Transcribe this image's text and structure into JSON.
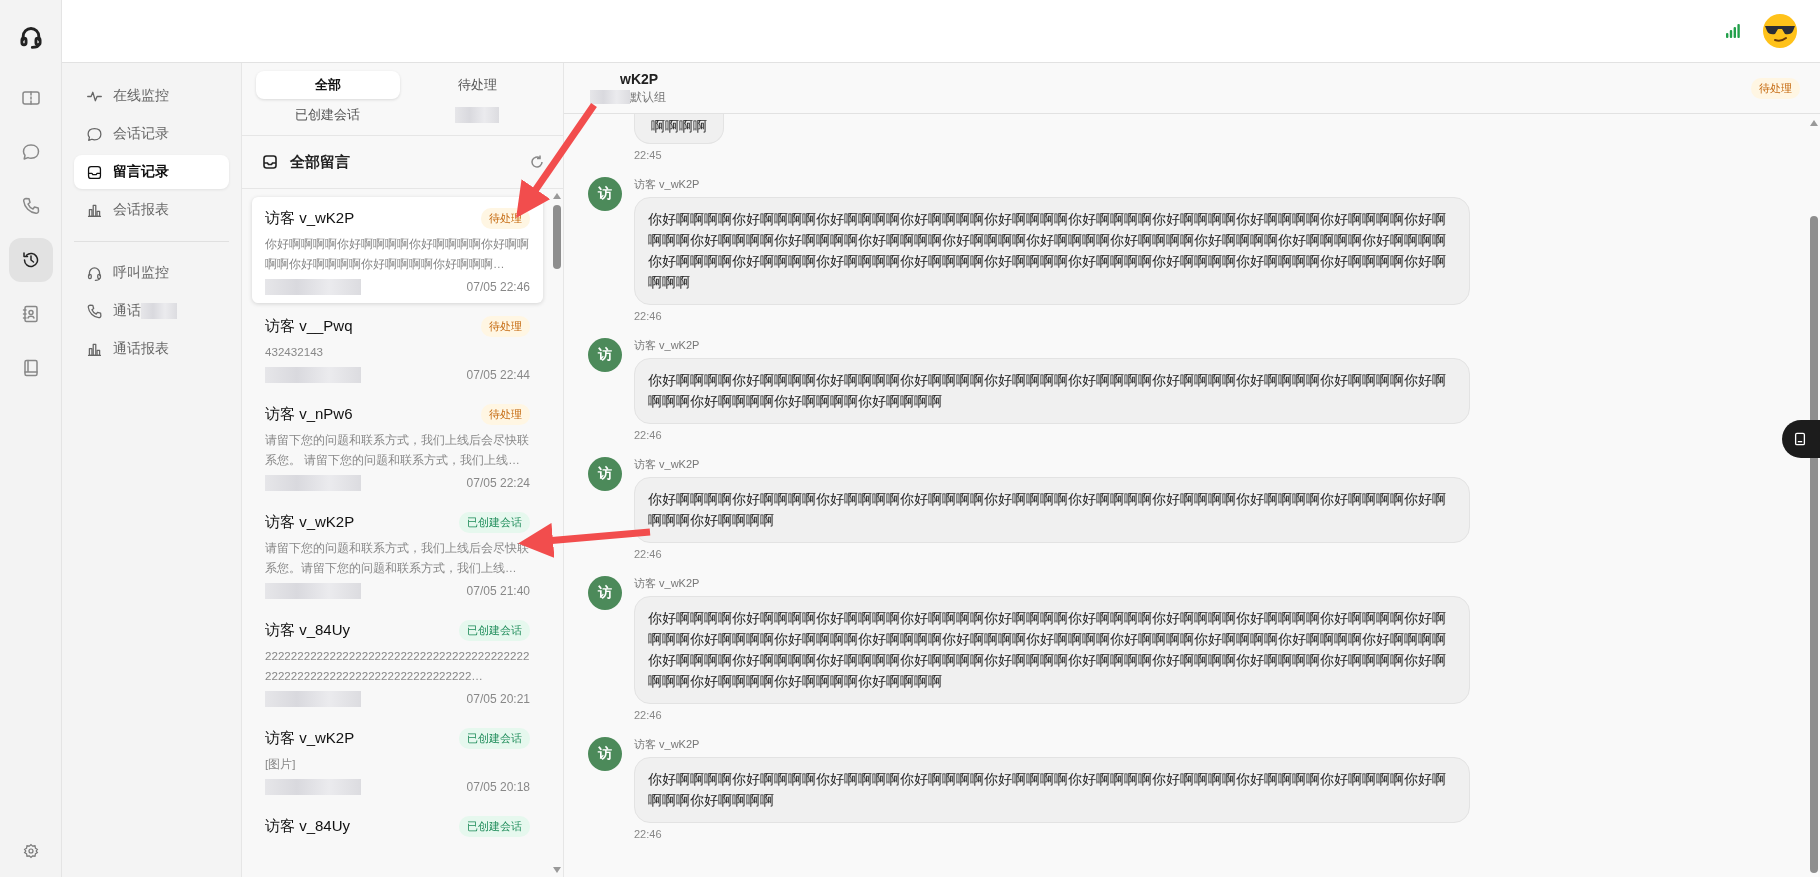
{
  "rail": {
    "items": [
      {
        "kind": "ticket",
        "selected": false
      },
      {
        "kind": "chat",
        "selected": false
      },
      {
        "kind": "phone",
        "selected": false
      },
      {
        "kind": "history",
        "selected": true
      },
      {
        "kind": "contacts",
        "selected": false
      },
      {
        "kind": "book",
        "selected": false
      }
    ]
  },
  "nav": {
    "groups": [
      [
        {
          "label": "在线监控",
          "kind": "pulse",
          "selected": false
        },
        {
          "label": "会话记录",
          "kind": "chat",
          "selected": false
        },
        {
          "label": "留言记录",
          "kind": "inbox",
          "selected": true
        },
        {
          "label": "会话报表",
          "kind": "chart",
          "selected": false
        }
      ],
      [
        {
          "label": "呼叫监控",
          "kind": "headset",
          "selected": false
        },
        {
          "label": "通话",
          "kind": "phone",
          "selected": false,
          "redacted": true
        },
        {
          "label": "通话报表",
          "kind": "chart",
          "selected": false
        }
      ]
    ]
  },
  "list": {
    "tabs": [
      {
        "label": "全部",
        "selected": true
      },
      {
        "label": "待处理",
        "selected": false
      },
      {
        "label": "已创建会话",
        "selected": false
      }
    ],
    "heading": "全部留言",
    "items": [
      {
        "visitor": "访客 v_wK2P",
        "status": {
          "kind": "pending",
          "label": "待处理"
        },
        "preview": "你好啊啊啊啊你好啊啊啊啊你好啊啊啊啊你好啊啊啊啊你好啊啊啊啊你好啊啊啊啊你好啊啊啊…",
        "time": "07/05 22:46",
        "selected": true
      },
      {
        "visitor": "访客 v__Pwq",
        "status": {
          "kind": "pending",
          "label": "待处理"
        },
        "preview": "432432143",
        "time": "07/05 22:44",
        "selected": false
      },
      {
        "visitor": "访客 v_nPw6",
        "status": {
          "kind": "pending",
          "label": "待处理"
        },
        "preview": "请留下您的问题和联系方式，我们上线后会尽快联系您。 请留下您的问题和联系方式，我们上线…",
        "time": "07/05 22:24",
        "selected": false
      },
      {
        "visitor": "访客 v_wK2P",
        "status": {
          "kind": "created",
          "label": "已创建会话"
        },
        "preview": "请留下您的问题和联系方式，我们上线后会尽快联系您。请留下您的问题和联系方式，我们上线…",
        "time": "07/05 21:40",
        "selected": false
      },
      {
        "visitor": "访客 v_84Uy",
        "status": {
          "kind": "created",
          "label": "已创建会话"
        },
        "preview": "2222222222222222222222222222222222222222222222222222222222222222222222222…",
        "time": "07/05 20:21",
        "selected": false
      },
      {
        "visitor": "访客 v_wK2P",
        "status": {
          "kind": "created",
          "label": "已创建会话"
        },
        "preview": "[图片]",
        "time": "07/05 20:18",
        "selected": false
      },
      {
        "visitor": "访客 v_84Uy",
        "status": {
          "kind": "created",
          "label": "已创建会话"
        },
        "selected": false
      }
    ]
  },
  "chat": {
    "title": "wK2P",
    "subtitle": "默认组",
    "status": {
      "kind": "pending",
      "label": "待处理"
    },
    "messages": [
      {
        "kind": "clipped",
        "text": "啊啊啊啊",
        "time": "22:45"
      },
      {
        "kind": "visitor",
        "avatar": "访",
        "sender": "访客 v_wK2P",
        "text": "你好啊啊啊啊你好啊啊啊啊你好啊啊啊啊你好啊啊啊啊你好啊啊啊啊你好啊啊啊啊你好啊啊啊啊你好啊啊啊啊你好啊啊啊啊你好啊啊啊啊你好啊啊啊啊你好啊啊啊啊你好啊啊啊啊你好啊啊啊啊你好啊啊啊啊你好啊啊啊啊你好啊啊啊啊你好啊啊啊啊你好啊啊啊啊你好啊啊啊啊你好啊啊啊啊你好啊啊啊啊你好啊啊啊啊你好啊啊啊啊你好啊啊啊啊你好啊啊啊啊你好啊啊啊啊你好啊啊啊啊你好啊啊啊啊",
        "time": "22:46"
      },
      {
        "kind": "visitor",
        "avatar": "访",
        "sender": "访客 v_wK2P",
        "text": "你好啊啊啊啊你好啊啊啊啊你好啊啊啊啊你好啊啊啊啊你好啊啊啊啊你好啊啊啊啊你好啊啊啊啊你好啊啊啊啊你好啊啊啊啊你好啊啊啊啊你好啊啊啊啊你好啊啊啊啊你好啊啊啊啊",
        "time": "22:46"
      },
      {
        "kind": "visitor",
        "avatar": "访",
        "sender": "访客 v_wK2P",
        "text": "你好啊啊啊啊你好啊啊啊啊你好啊啊啊啊你好啊啊啊啊你好啊啊啊啊你好啊啊啊啊你好啊啊啊啊你好啊啊啊啊你好啊啊啊啊你好啊啊啊啊你好啊啊啊啊",
        "time": "22:46"
      },
      {
        "kind": "visitor",
        "avatar": "访",
        "sender": "访客 v_wK2P",
        "text": "你好啊啊啊啊你好啊啊啊啊你好啊啊啊啊你好啊啊啊啊你好啊啊啊啊你好啊啊啊啊你好啊啊啊啊你好啊啊啊啊你好啊啊啊啊你好啊啊啊啊你好啊啊啊啊你好啊啊啊啊你好啊啊啊啊你好啊啊啊啊你好啊啊啊啊你好啊啊啊啊你好啊啊啊啊你好啊啊啊啊你好啊啊啊啊你好啊啊啊啊你好啊啊啊啊你好啊啊啊啊你好啊啊啊啊你好啊啊啊啊你好啊啊啊啊你好啊啊啊啊你好啊啊啊啊你好啊啊啊啊你好啊啊啊啊你好啊啊啊啊你好啊啊啊啊你好啊啊啊啊",
        "time": "22:46"
      },
      {
        "kind": "visitor",
        "avatar": "访",
        "sender": "访客 v_wK2P",
        "text": "你好啊啊啊啊你好啊啊啊啊你好啊啊啊啊你好啊啊啊啊你好啊啊啊啊你好啊啊啊啊你好啊啊啊啊你好啊啊啊啊你好啊啊啊啊你好啊啊啊啊你好啊啊啊啊",
        "time": "22:46"
      }
    ]
  }
}
